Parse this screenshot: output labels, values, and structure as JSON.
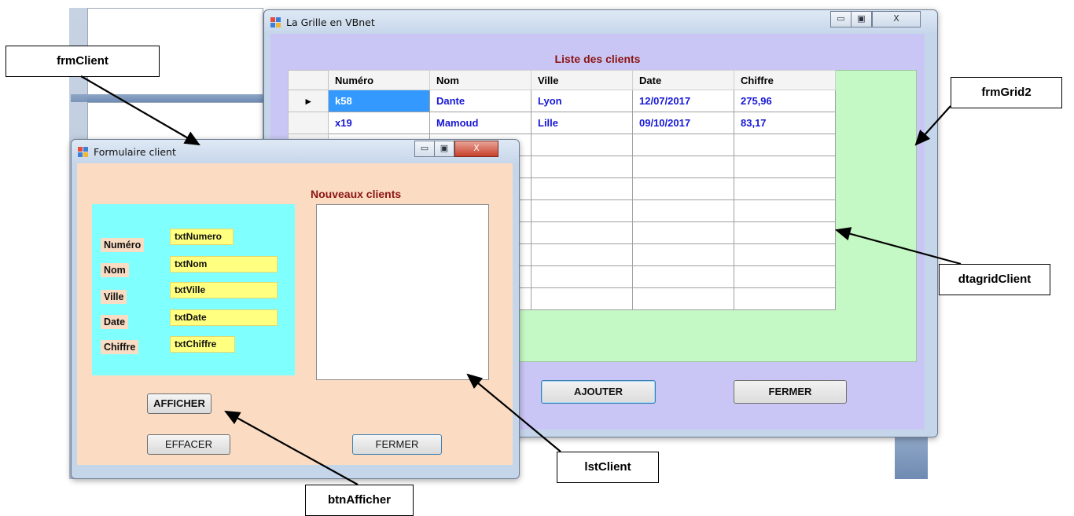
{
  "grid_window": {
    "title": "La Grille en VBnet",
    "list_title": "Liste des clients",
    "columns": [
      "Numéro",
      "Nom",
      "Ville",
      "Date",
      "Chiffre"
    ],
    "rows": [
      [
        "k58",
        "Dante",
        "Lyon",
        "12/07/2017",
        "275,96"
      ],
      [
        "x19",
        "Mamoud",
        "Lille",
        "09/10/2017",
        "83,17"
      ]
    ],
    "row_indicator": "▸",
    "add_button": "AJOUTER",
    "close_button": "FERMER"
  },
  "client_form": {
    "title": "Formulaire client",
    "new_clients_label": "Nouveaux clients",
    "labels": {
      "numero": "Numéro",
      "nom": "Nom",
      "ville": "Ville",
      "date": "Date",
      "chiffre": "Chiffre"
    },
    "fields": {
      "numero": "txtNumero",
      "nom": "txtNom",
      "ville": "txtVille",
      "date": "txtDate",
      "chiffre": "txtChiffre"
    },
    "afficher_button": "AFFICHER",
    "effacer_button": "EFFACER",
    "fermer_button": "FERMER"
  },
  "title_buttons": {
    "minimize": "▭",
    "maximize": "▣",
    "close": "X"
  },
  "callouts": {
    "frmClient": "frmClient",
    "frmGrid2": "frmGrid2",
    "dtagridClient": "dtagridClient",
    "lstClient": "lstClient",
    "btnAfficher": "btnAfficher"
  }
}
